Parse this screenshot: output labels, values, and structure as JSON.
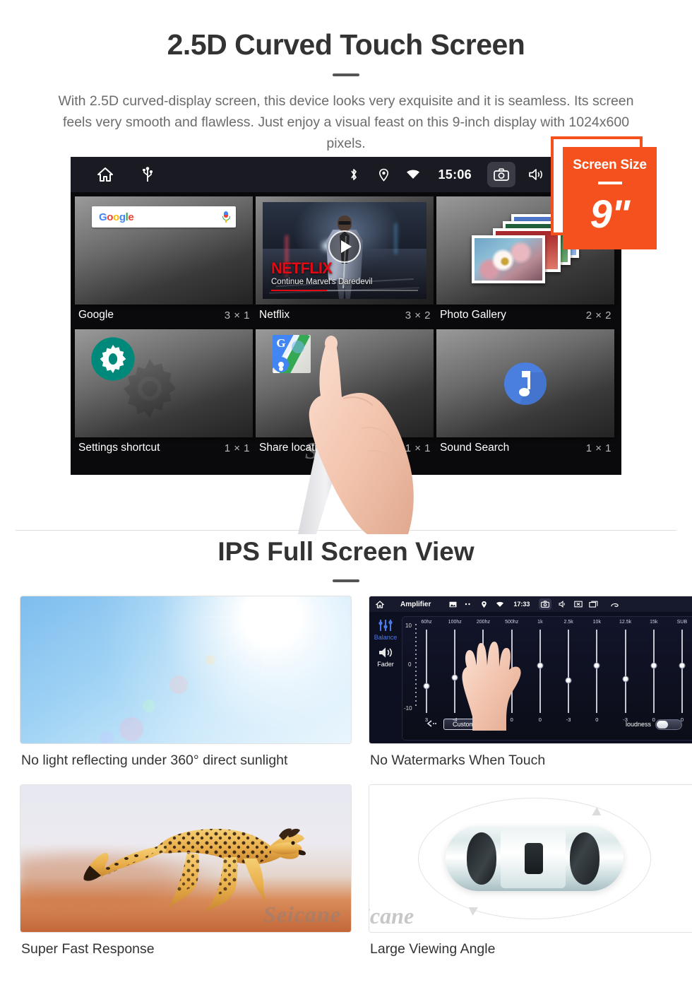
{
  "section1": {
    "title": "2.5D Curved Touch Screen",
    "description": "With 2.5D curved-display screen, this device looks very exquisite and it is seamless. Its screen feels very smooth and flawless. Just enjoy a visual feast on this 9-inch display with 1024x600 pixels."
  },
  "badge": {
    "label": "Screen Size",
    "value": "9\"",
    "color": "#F4511E"
  },
  "android": {
    "statusbar": {
      "time": "15:06",
      "left_icons": [
        "home-icon",
        "usb-icon"
      ],
      "right_icons": [
        "bluetooth-icon",
        "location-icon",
        "wifi-icon",
        "camera-icon",
        "volume-icon",
        "close-icon",
        "recents-icon"
      ]
    },
    "google_widget": {
      "logo_letters": [
        "G",
        "o",
        "o",
        "g",
        "l",
        "e"
      ],
      "mic": "mic-icon"
    },
    "netflix_widget": {
      "logo": "NETFLIX",
      "subtitle": "Continue Marvel's Daredevil",
      "progress_percent": 38
    },
    "widgets": [
      {
        "name": "Google",
        "size": "3 × 1"
      },
      {
        "name": "Netflix",
        "size": "3 × 2"
      },
      {
        "name": "Photo Gallery",
        "size": "2 × 2"
      },
      {
        "name": "Settings shortcut",
        "size": "1 × 1"
      },
      {
        "name": "Share location",
        "size": "1 × 1"
      },
      {
        "name": "Sound Search",
        "size": "1 × 1"
      }
    ],
    "watermark": "Seicane"
  },
  "section2": {
    "title": "IPS Full Screen View",
    "cards": [
      {
        "caption": "No light reflecting under 360° direct sunlight",
        "image": "sunlight-photo"
      },
      {
        "caption": "No Watermarks When Touch",
        "image": "amplifier-screenshot"
      },
      {
        "caption": "Super Fast Response",
        "image": "cheetah-photo"
      },
      {
        "caption": "Large Viewing Angle",
        "image": "car-top-view-illustration"
      }
    ]
  },
  "amplifier": {
    "title": "Amplifier",
    "time": "17:33",
    "side_controls": [
      {
        "label": "Balance",
        "active": true
      },
      {
        "label": "Fader",
        "active": false
      }
    ],
    "scale": {
      "top": "10",
      "mid": "0",
      "bottom": "-10"
    },
    "bands": [
      {
        "freq": "60hz",
        "value": "3"
      },
      {
        "freq": "100hz",
        "value": "-4"
      },
      {
        "freq": "200hz",
        "value": "0"
      },
      {
        "freq": "500hz",
        "value": "0"
      },
      {
        "freq": "1k",
        "value": "0"
      },
      {
        "freq": "2.5k",
        "value": "-3"
      },
      {
        "freq": "10k",
        "value": "0"
      },
      {
        "freq": "12.5k",
        "value": "-3"
      },
      {
        "freq": "15k",
        "value": "0"
      },
      {
        "freq": "SUB",
        "value": "0"
      }
    ],
    "preset": "Custom",
    "loudness_label": "loudness",
    "loudness_on": false
  },
  "watermarks": {
    "cheetah": "Seicane",
    "car": "icane"
  }
}
